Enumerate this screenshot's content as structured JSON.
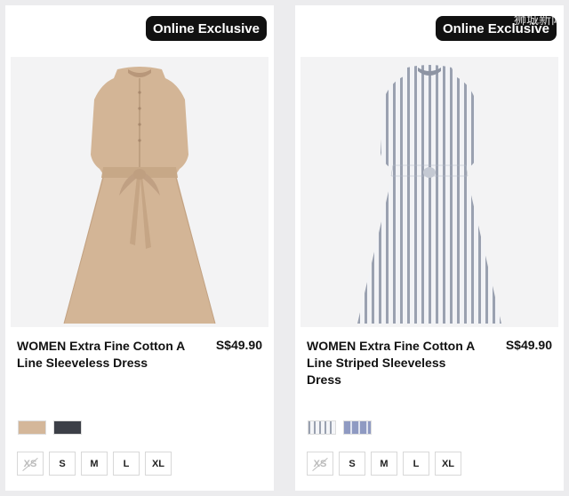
{
  "products": [
    {
      "badge": "Online Exclusive",
      "title": "WOMEN Extra Fine Cotton A Line Sleeveless Dress",
      "price": "S$49.90",
      "colors": [
        "#d4b79a",
        "#3c3f47"
      ],
      "sizes": [
        {
          "label": "XS",
          "available": false
        },
        {
          "label": "S",
          "available": true
        },
        {
          "label": "M",
          "available": true
        },
        {
          "label": "L",
          "available": true
        },
        {
          "label": "XL",
          "available": true
        }
      ]
    },
    {
      "badge": "Online Exclusive",
      "title": "WOMEN Extra Fine Cotton A Line Striped Sleeveless Dress",
      "price": "S$49.90",
      "colors": [
        "striped-white-grey",
        "#a8b2cf"
      ],
      "sizes": [
        {
          "label": "XS",
          "available": false
        },
        {
          "label": "S",
          "available": true
        },
        {
          "label": "M",
          "available": true
        },
        {
          "label": "L",
          "available": true
        },
        {
          "label": "XL",
          "available": true
        }
      ]
    }
  ],
  "watermark": "狮城新闻"
}
